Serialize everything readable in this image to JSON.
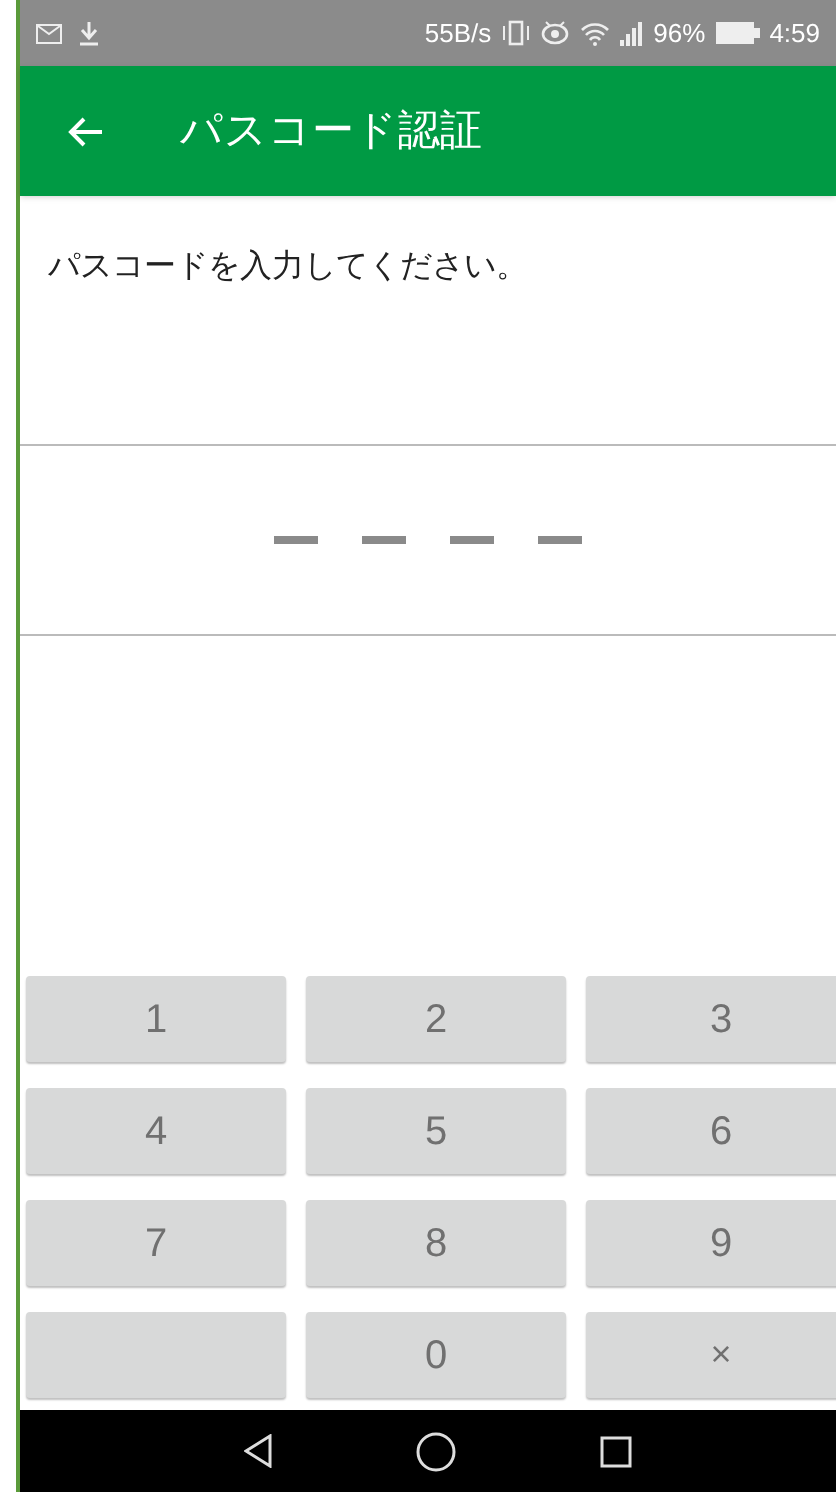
{
  "status_bar": {
    "speed": "55B/s",
    "battery_percent": "96%",
    "time": "4:59"
  },
  "app_bar": {
    "title": "パスコード認証"
  },
  "prompt": "パスコードを入力してください。",
  "passcode": [
    {
      "filled": false
    },
    {
      "filled": false
    },
    {
      "filled": false
    },
    {
      "filled": false
    }
  ],
  "keypad": [
    {
      "kind": "digit",
      "label": "1"
    },
    {
      "kind": "digit",
      "label": "2"
    },
    {
      "kind": "digit",
      "label": "3"
    },
    {
      "kind": "digit",
      "label": "4"
    },
    {
      "kind": "digit",
      "label": "5"
    },
    {
      "kind": "digit",
      "label": "6"
    },
    {
      "kind": "digit",
      "label": "7"
    },
    {
      "kind": "digit",
      "label": "8"
    },
    {
      "kind": "digit",
      "label": "9"
    },
    {
      "kind": "blank"
    },
    {
      "kind": "digit",
      "label": "0"
    },
    {
      "kind": "delete",
      "label": "×"
    }
  ]
}
